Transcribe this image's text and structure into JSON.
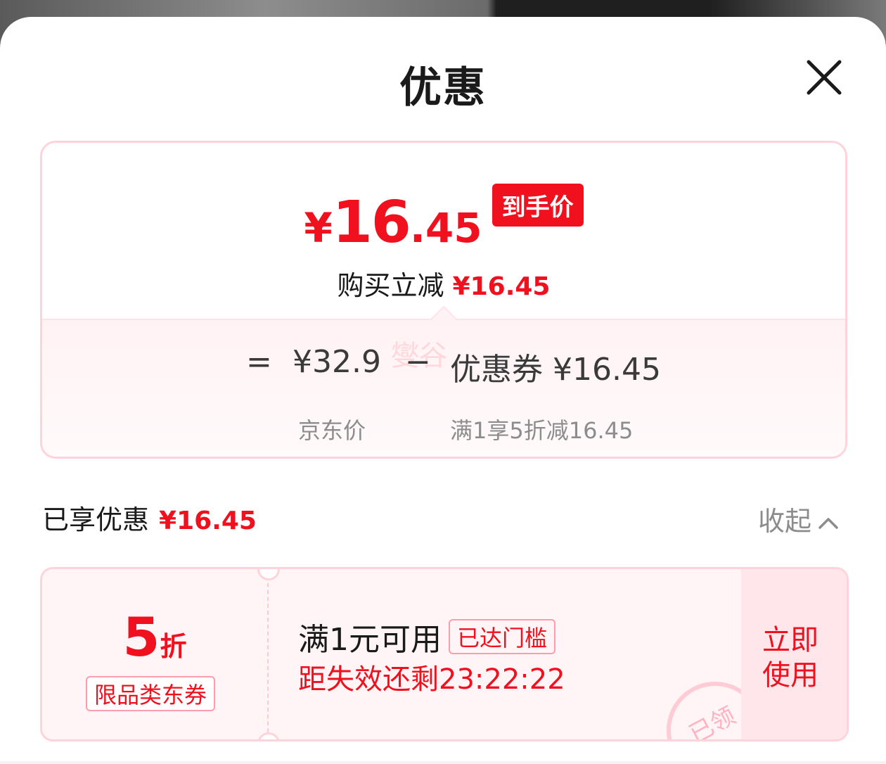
{
  "header": {
    "title": "优惠",
    "close_icon": "close-icon"
  },
  "summary": {
    "final_price": {
      "currency": "¥",
      "integer": "16",
      "decimal": ".45",
      "badge": "到手价"
    },
    "reduce": {
      "label": "购买立减",
      "amount": "¥16.45"
    },
    "formula": {
      "equals": "=",
      "jd_price": "¥32.9",
      "jd_price_label": "京东价",
      "minus": "−",
      "coupon_label": "优惠券",
      "coupon_amount": "¥16.45",
      "coupon_rule": "满1享5折减16.45"
    },
    "watermark": "燮谷"
  },
  "enjoyed": {
    "label": "已享优惠",
    "amount": "¥16.45",
    "collapse_label": "收起",
    "collapse_icon": "chevron-up-icon"
  },
  "coupon": {
    "discount_value": "5",
    "discount_unit": "折",
    "scope": "限品类东券",
    "condition": "满1元可用",
    "threshold_tag": "已达门槛",
    "expire_text": "距失效还剩23:22:22",
    "use_button": "立即使用",
    "stamp_text": "已领"
  },
  "colors": {
    "accent_red": "#f0101e",
    "border_pink": "#ffd3db",
    "coupon_bg": "#fff5f6"
  }
}
